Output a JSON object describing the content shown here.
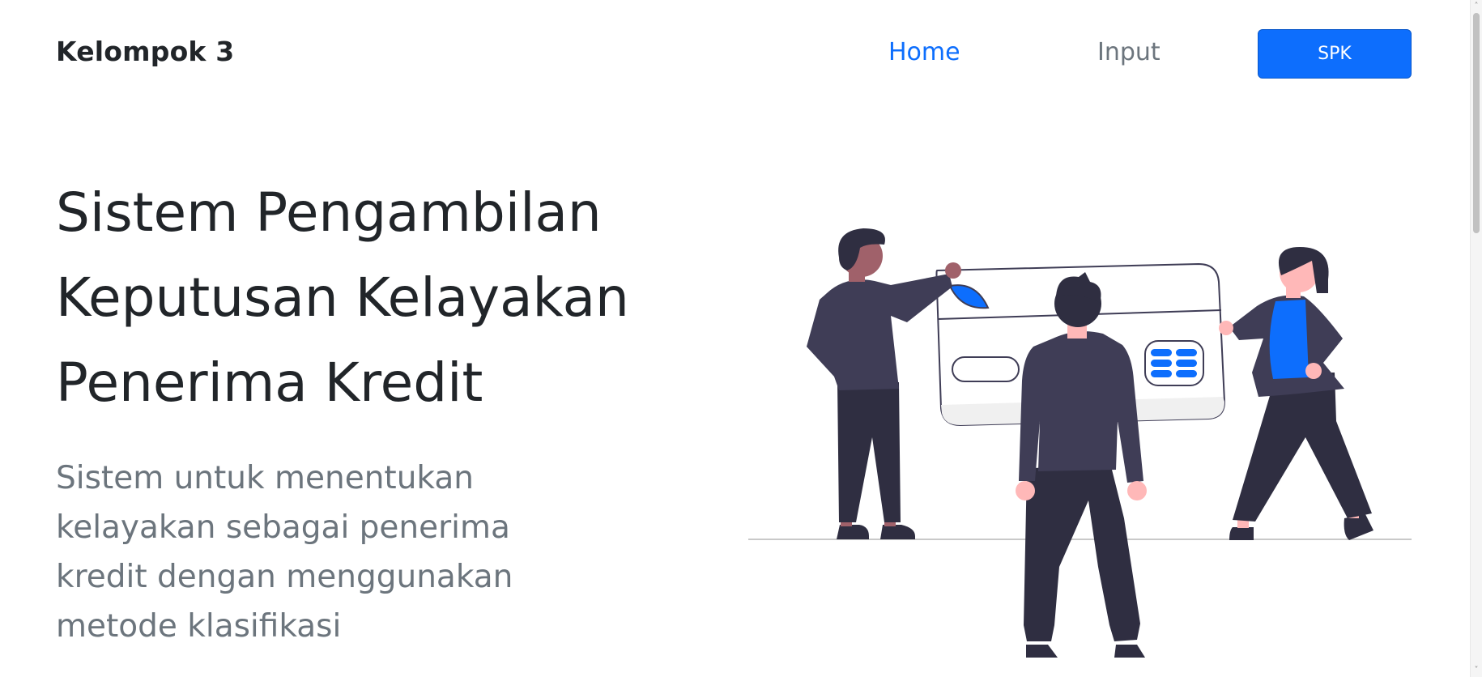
{
  "navbar": {
    "brand": "Kelompok 3",
    "links": [
      {
        "label": "Home",
        "active": true
      },
      {
        "label": "Input",
        "active": false
      }
    ],
    "cta_label": "SPK"
  },
  "hero": {
    "title_lines": [
      "Sistem Pengambilan",
      "Keputusan Kelayakan",
      "Penerima Kredit"
    ],
    "description_lines": [
      "Sistem untuk menentukan",
      "kelayakan sebagai penerima",
      "kredit dengan menggunakan",
      "metode klasifikasi"
    ]
  },
  "illustration": {
    "icon": "people-credit-card-illustration"
  },
  "colors": {
    "primary": "#0d6efd",
    "text": "#212529",
    "muted": "#6c757d",
    "figure_dark": "#3f3d56",
    "figure_pants": "#2f2e41",
    "skin_light": "#ffb8b8",
    "skin_dark": "#a0616a"
  }
}
